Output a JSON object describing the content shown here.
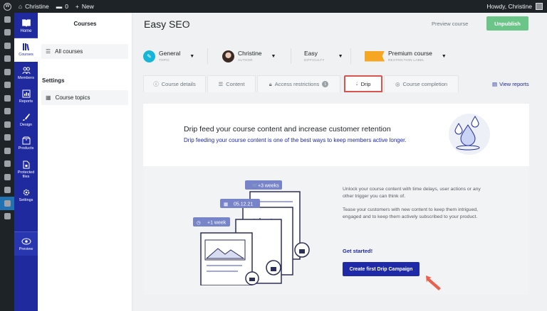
{
  "wpbar": {
    "site": "Christine",
    "comments": "0",
    "new": "New",
    "howdy": "Howdy, Christine"
  },
  "mp_nav": {
    "home": "Home",
    "items": [
      "Courses",
      "Members",
      "Reports",
      "Design",
      "Products",
      "Protected files",
      "Settings"
    ],
    "preview": "Preview"
  },
  "subnav": {
    "title": "Courses",
    "all_courses": "All courses",
    "settings_header": "Settings",
    "course_topics": "Course topics"
  },
  "header": {
    "title": "Easy SEO",
    "preview": "Preview course",
    "unpublish": "Unpublish"
  },
  "meta": [
    {
      "label": "General",
      "sub": "TOPIC"
    },
    {
      "label": "Christine",
      "sub": "AUTHOR"
    },
    {
      "label": "Easy",
      "sub": "DIFFICULTY"
    },
    {
      "label": "Premium course",
      "sub": "RESTRICTION LABEL"
    }
  ],
  "tabs": {
    "details": "Course details",
    "content": "Content",
    "access": "Access restrictions",
    "access_count": "1",
    "drip": "Drip",
    "completion": "Course completion",
    "view_reports": "View reports"
  },
  "drip": {
    "heading": "Drip feed your course content and increase customer retention",
    "subheading": "Drip feeding your course content is one of the best ways to keep members active longer.",
    "para1": "Unlock your course content with time delays, user actions or any other trigger you can think of.",
    "para2": "Tease your customers with new content to keep them intrigued, engaged and to keep them actively subscribed to your product.",
    "get_started": "Get started!",
    "cta": "Create first Drip Campaign",
    "tag1": "+3 weeks",
    "tag2": "05.12.21",
    "tag3": "+1 week"
  },
  "colors": {
    "brand": "#1f2a9e",
    "unpublish": "#6bc488",
    "highlight": "#d9534f"
  }
}
